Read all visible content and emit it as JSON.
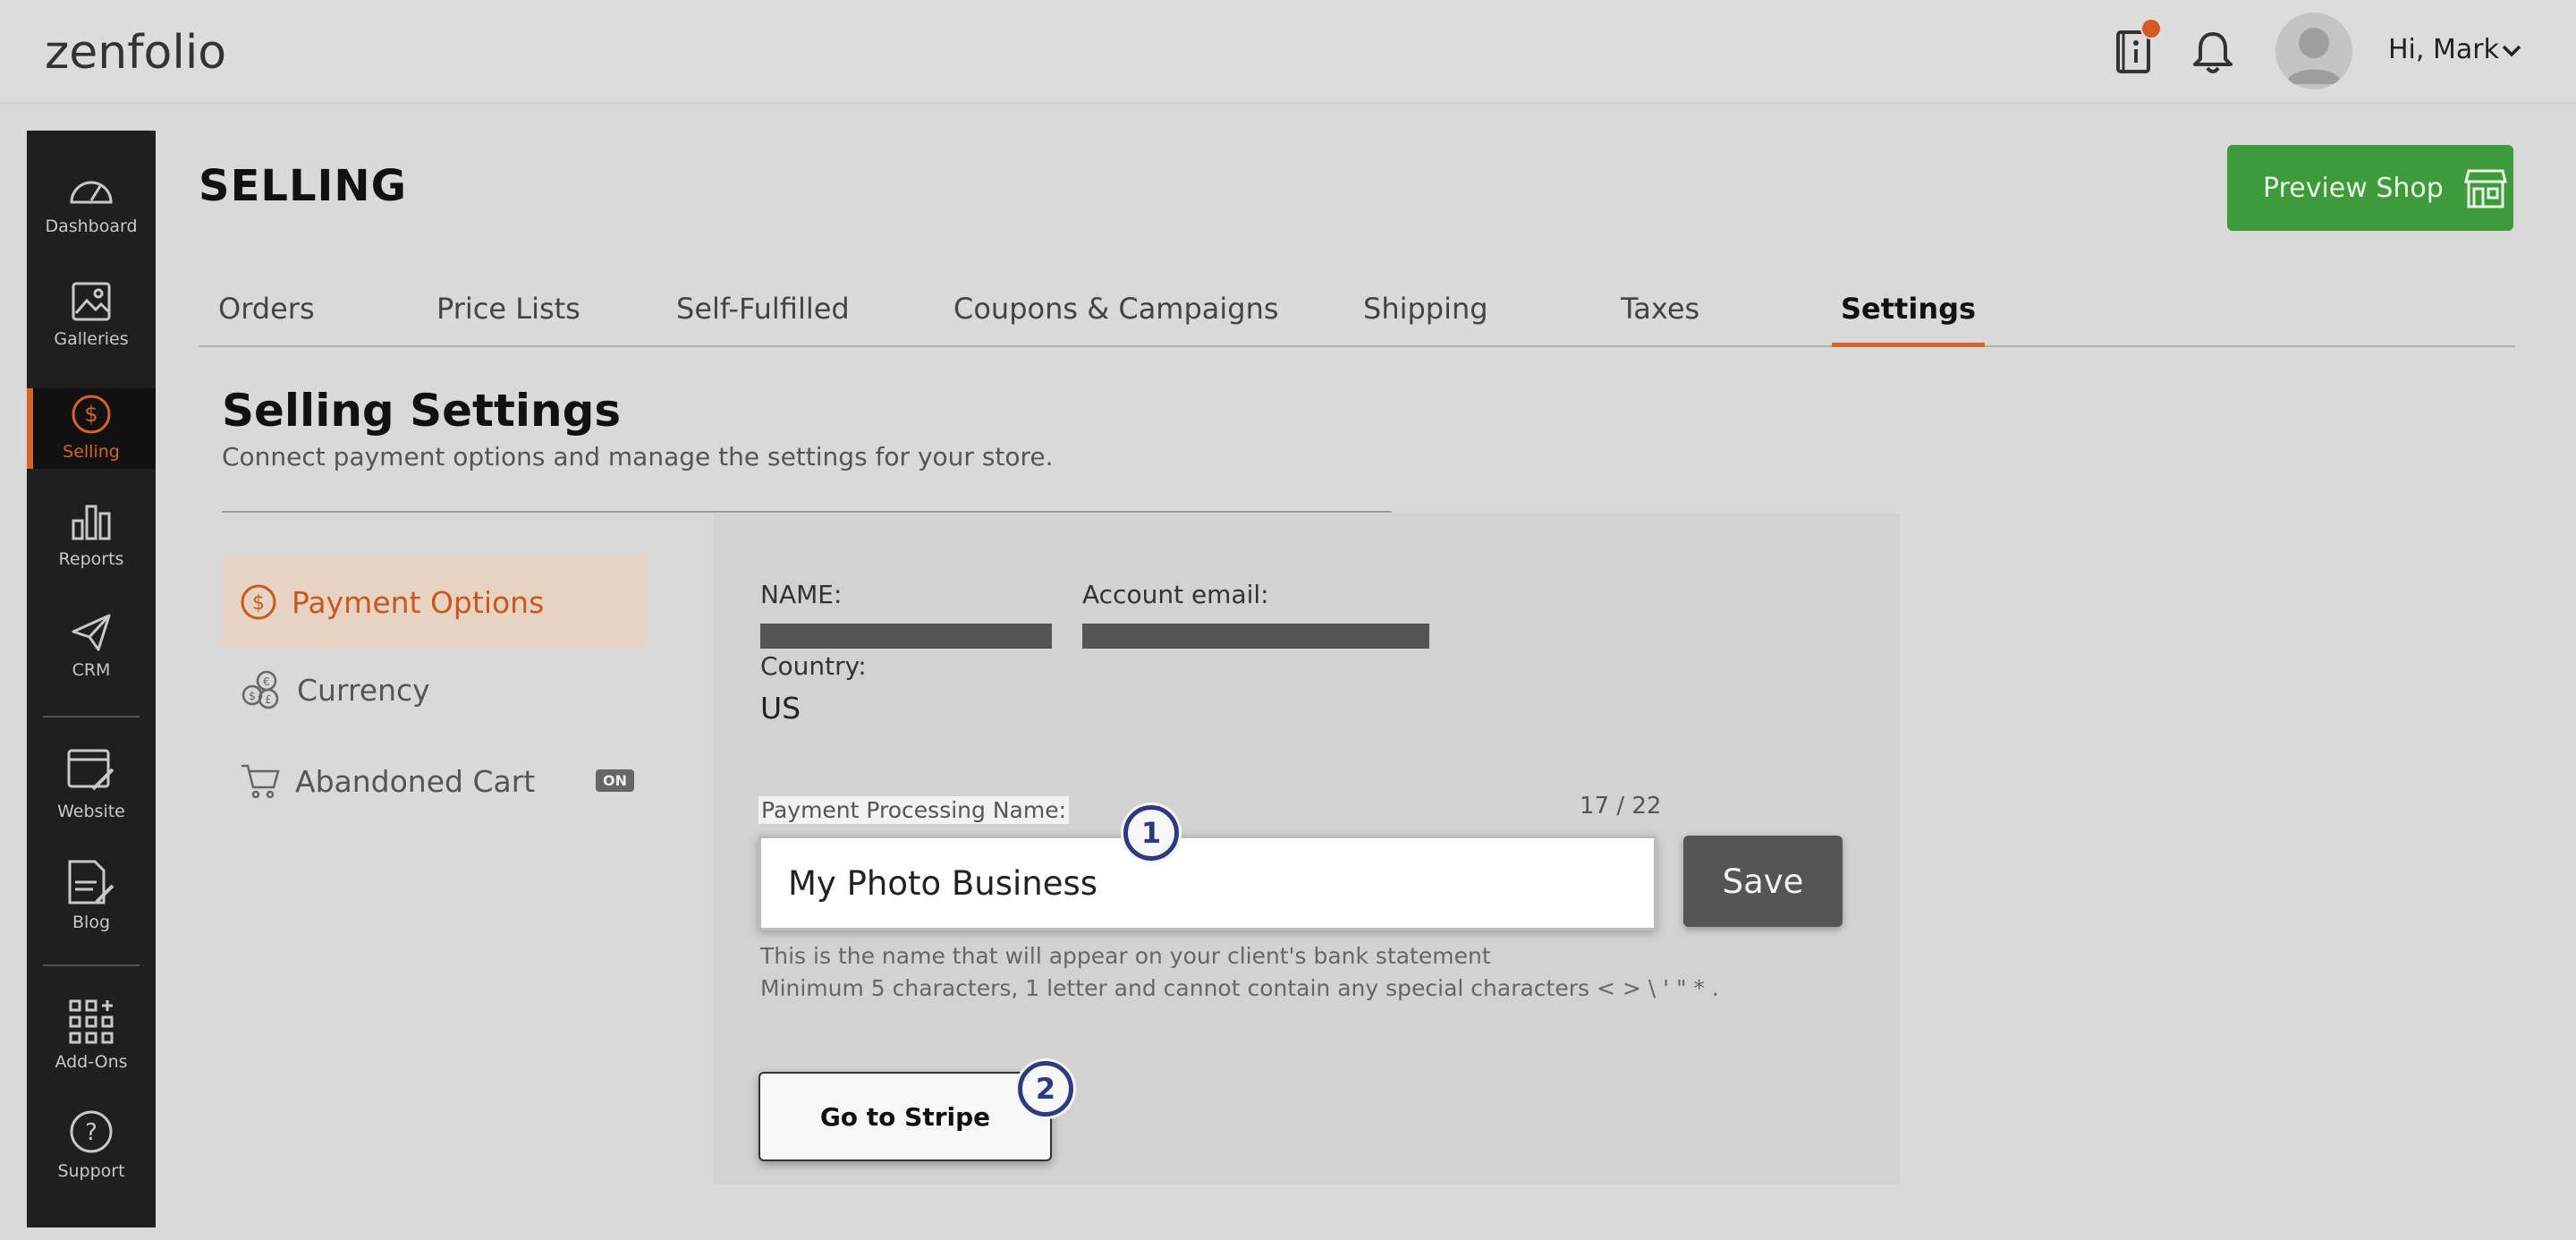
{
  "header": {
    "logo_text": "zenfolio",
    "greeting": "Hi, Mark"
  },
  "rail": {
    "items": [
      {
        "label": "Dashboard"
      },
      {
        "label": "Galleries"
      },
      {
        "label": "Selling"
      },
      {
        "label": "Reports"
      },
      {
        "label": "CRM"
      },
      {
        "label": "Website"
      },
      {
        "label": "Blog"
      },
      {
        "label": "Add-Ons"
      },
      {
        "label": "Support"
      }
    ],
    "active": "Selling"
  },
  "page": {
    "title": "SELLING",
    "preview_label": "Preview Shop"
  },
  "tabs": [
    {
      "label": "Orders"
    },
    {
      "label": "Price Lists"
    },
    {
      "label": "Self-Fulfilled"
    },
    {
      "label": "Coupons & Campaigns"
    },
    {
      "label": "Shipping"
    },
    {
      "label": "Taxes"
    },
    {
      "label": "Settings"
    }
  ],
  "settings": {
    "title": "Selling Settings",
    "subtitle": "Connect payment options and manage the settings for your store.",
    "menu": [
      {
        "label": "Payment Options"
      },
      {
        "label": "Currency"
      },
      {
        "label": "Abandoned Cart",
        "badge": "ON"
      }
    ]
  },
  "payment": {
    "name_label": "NAME:",
    "email_label": "Account email:",
    "country_label": "Country:",
    "country_value": "US",
    "processing_label": "Payment Processing Name:",
    "counter": "17 / 22",
    "processing_value": "My Photo Business",
    "save_label": "Save",
    "hint_1": "This is the name that will appear on your client's bank statement",
    "hint_2": "Minimum 5 characters, 1 letter and cannot contain any special characters < > \\ ' \" * .",
    "stripe_label": "Go to Stripe"
  },
  "callouts": [
    "1",
    "2"
  ],
  "colors": {
    "accent": "#d5632a",
    "preview_green": "#3e9b3a",
    "callout_blue": "#2d3a80"
  }
}
